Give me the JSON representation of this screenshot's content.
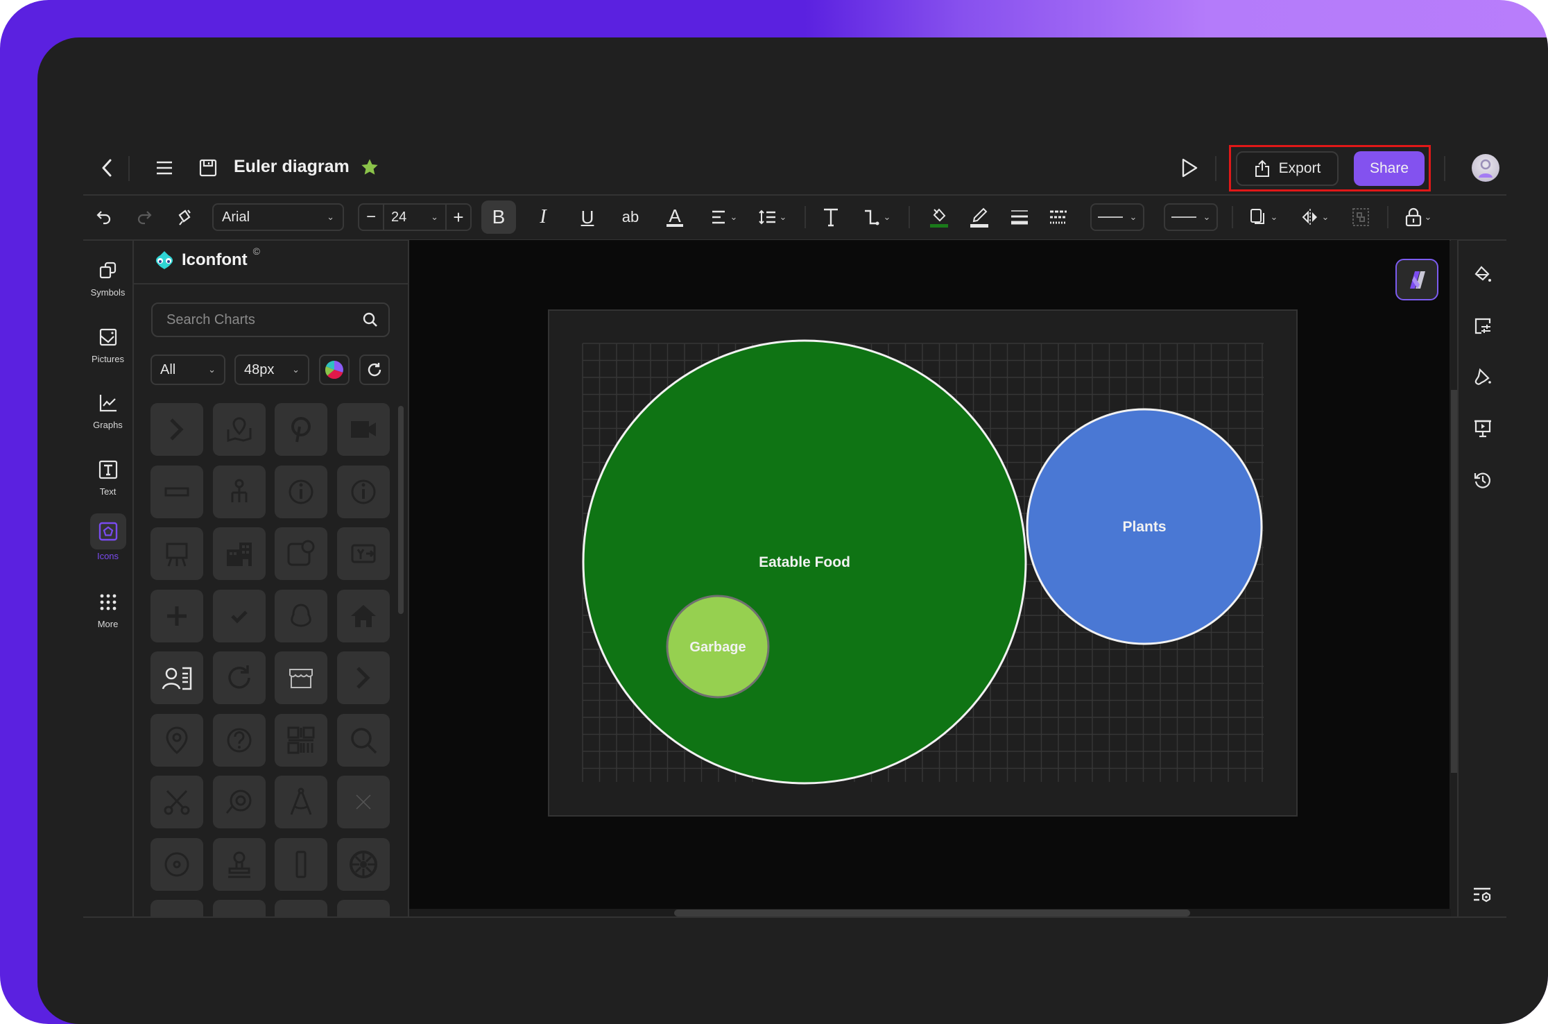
{
  "header": {
    "title": "Euler diagram",
    "export_label": "Export",
    "share_label": "Share",
    "accent_color": "#8352ef",
    "favorite_color": "#8bc34a"
  },
  "toolbar": {
    "font_family": "Arial",
    "font_size": "24",
    "text_format_buttons": [
      "B",
      "I",
      "U",
      "ab",
      "A"
    ],
    "fill_color": "#1a7a1a"
  },
  "left_rail": {
    "items": [
      {
        "label": "Symbols",
        "icon": "symbols-icon",
        "active": false
      },
      {
        "label": "Pictures",
        "icon": "pictures-icon",
        "active": false
      },
      {
        "label": "Graphs",
        "icon": "graphs-icon",
        "active": false
      },
      {
        "label": "Text",
        "icon": "text-icon",
        "active": false
      },
      {
        "label": "Icons",
        "icon": "icons-icon",
        "active": true
      },
      {
        "label": "More",
        "icon": "more-icon",
        "active": false
      }
    ]
  },
  "panel": {
    "brand": "Iconfont",
    "brand_mark": "©",
    "search_placeholder": "Search Charts",
    "category_filter": "All",
    "size_filter": "48px",
    "icon_tiles": [
      "chevron-right",
      "map-pin",
      "pinterest",
      "video-camera",
      "ruler",
      "org-chart",
      "info-circle",
      "info-circle",
      "easel",
      "buildings",
      "wallet-yen",
      "yen-transfer",
      "plus",
      "check",
      "qq-penguin",
      "home",
      "contact-card",
      "refresh",
      "storefront",
      "chevron-right",
      "location-pin",
      "help-circle",
      "qr-code",
      "search",
      "scissors",
      "lasso",
      "compass-drawing",
      "close",
      "disc",
      "stamp",
      "cylinder",
      "wheel"
    ]
  },
  "diagram": {
    "type": "euler",
    "sets": [
      {
        "name": "Eatable Food",
        "color": "#0f7414",
        "stroke": "#f2f2f2"
      },
      {
        "name": "Plants",
        "color": "#4a78d4",
        "stroke": "#f2f2f2"
      },
      {
        "name": "Garbage",
        "color": "#96d050",
        "stroke": "#707070",
        "inside": "Eatable Food"
      }
    ],
    "relations": [
      "Garbage is a subset of Eatable Food",
      "Plants is disjoint from Eatable Food"
    ]
  }
}
